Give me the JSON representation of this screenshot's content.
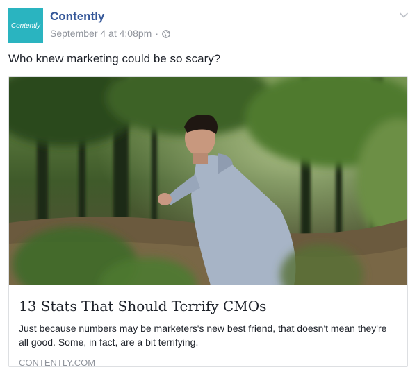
{
  "post": {
    "page_name": "Contently",
    "avatar_text": "Contently",
    "timestamp": "September 4 at 4:08pm",
    "separator": "·",
    "privacy_icon": "globe-icon",
    "menu_icon": "chevron-down-icon",
    "message": "Who knew marketing could be so scary?"
  },
  "link": {
    "image_icon": "photo-man-running-in-forest",
    "title": "13 Stats That Should Terrify CMOs",
    "description": "Just because numbers may be marketers's new best friend, that doesn't mean they're all good. Some, in fact, are a bit terrifying.",
    "domain": "CONTENTLY.COM"
  },
  "colors": {
    "brand": "#2ab4c0",
    "link_blue": "#365899",
    "muted": "#90949c",
    "text": "#1d2129"
  }
}
